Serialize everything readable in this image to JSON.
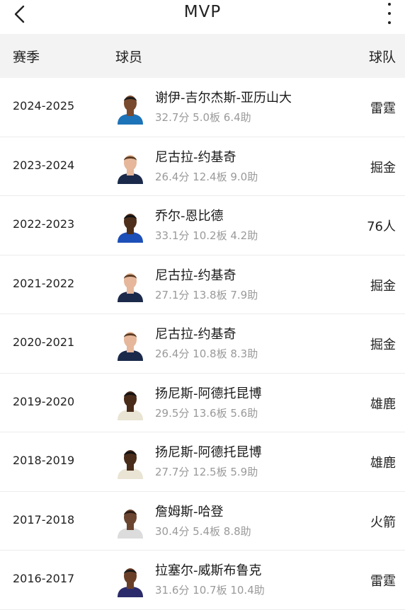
{
  "header": {
    "title": "MVP"
  },
  "columns": {
    "season": "赛季",
    "player": "球员",
    "team": "球队"
  },
  "rows": [
    {
      "season": "2024-2025",
      "name": "谢伊-吉尔杰斯-亚历山大",
      "stats": "32.7分 5.0板 6.4助",
      "team": "雷霆",
      "jersey": "#1d73b8",
      "skin": "#7a4a2e",
      "hair": "#1a1a1a"
    },
    {
      "season": "2023-2024",
      "name": "尼古拉-约基奇",
      "stats": "26.4分 12.4板 9.0助",
      "team": "掘金",
      "jersey": "#1b2a4a",
      "skin": "#e6b79a",
      "hair": "#5a3b22"
    },
    {
      "season": "2022-2023",
      "name": "乔尔-恩比德",
      "stats": "33.1分 10.2板 4.2助",
      "team": "76人",
      "jersey": "#1d4fb8",
      "skin": "#4e2f1c",
      "hair": "#111111"
    },
    {
      "season": "2021-2022",
      "name": "尼古拉-约基奇",
      "stats": "27.1分 13.8板 7.9助",
      "team": "掘金",
      "jersey": "#1b2a4a",
      "skin": "#e6b79a",
      "hair": "#5a3b22"
    },
    {
      "season": "2020-2021",
      "name": "尼古拉-约基奇",
      "stats": "26.4分 10.8板 8.3助",
      "team": "掘金",
      "jersey": "#1b2a4a",
      "skin": "#e6b79a",
      "hair": "#5a3b22"
    },
    {
      "season": "2019-2020",
      "name": "扬尼斯-阿德托昆博",
      "stats": "29.5分 13.6板 5.6助",
      "team": "雄鹿",
      "jersey": "#e9e4d3",
      "skin": "#4a2c1a",
      "hair": "#111111"
    },
    {
      "season": "2018-2019",
      "name": "扬尼斯-阿德托昆博",
      "stats": "27.7分 12.5板 5.9助",
      "team": "雄鹿",
      "jersey": "#e9e4d3",
      "skin": "#4a2c1a",
      "hair": "#111111"
    },
    {
      "season": "2017-2018",
      "name": "詹姆斯-哈登",
      "stats": "30.4分 5.4板 8.8助",
      "team": "火箭",
      "jersey": "#dcdcdc",
      "skin": "#6b4530",
      "hair": "#2a1a12"
    },
    {
      "season": "2016-2017",
      "name": "拉塞尔-威斯布鲁克",
      "stats": "31.6分 10.7板 10.4助",
      "team": "雷霆",
      "jersey": "#2b2b6b",
      "skin": "#6a3f28",
      "hair": "#1a1a1a"
    }
  ]
}
